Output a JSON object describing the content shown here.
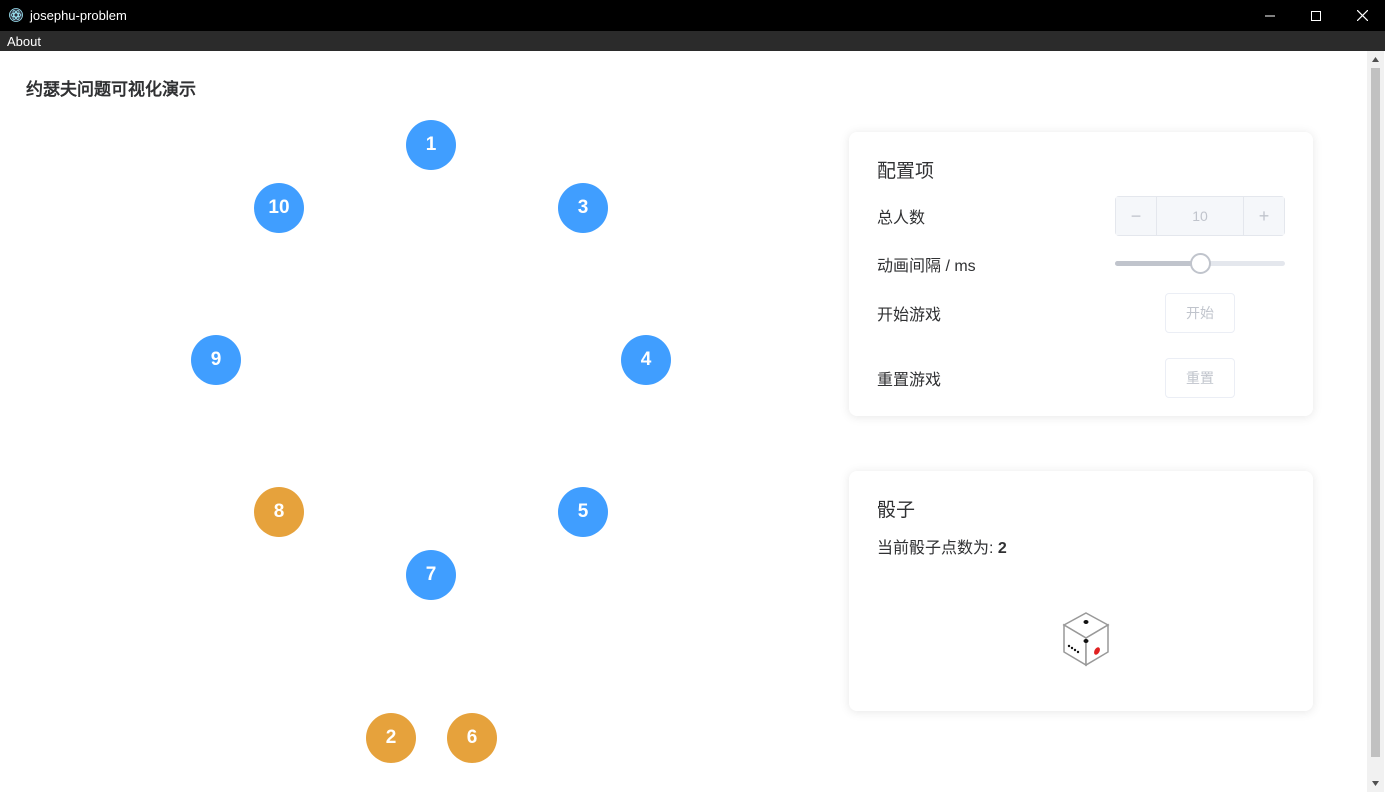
{
  "window": {
    "title": "josephu-problem",
    "app_icon": "electron-icon"
  },
  "menu": {
    "items": [
      "About"
    ]
  },
  "page": {
    "title": "约瑟夫问题可视化演示"
  },
  "people": [
    {
      "number": "1",
      "state": "active"
    },
    {
      "number": "10",
      "state": "active"
    },
    {
      "number": "3",
      "state": "active"
    },
    {
      "number": "9",
      "state": "active"
    },
    {
      "number": "4",
      "state": "active"
    },
    {
      "number": "8",
      "state": "eliminated"
    },
    {
      "number": "5",
      "state": "active"
    },
    {
      "number": "7",
      "state": "active"
    },
    {
      "number": "2",
      "state": "eliminated"
    },
    {
      "number": "6",
      "state": "eliminated"
    }
  ],
  "colors": {
    "active": "#409eff",
    "eliminated": "#e6a23c"
  },
  "config": {
    "title": "配置项",
    "total_label": "总人数",
    "total_value": "10",
    "minus": "−",
    "plus": "+",
    "interval_label": "动画间隔 / ms",
    "interval_fraction": 0.5,
    "start_label": "开始游戏",
    "start_button": "开始",
    "reset_label": "重置游戏",
    "reset_button": "重置"
  },
  "dice": {
    "title": "骰子",
    "points_label": "当前骰子点数为:",
    "points_value": "2",
    "icon": "dice-icon"
  }
}
